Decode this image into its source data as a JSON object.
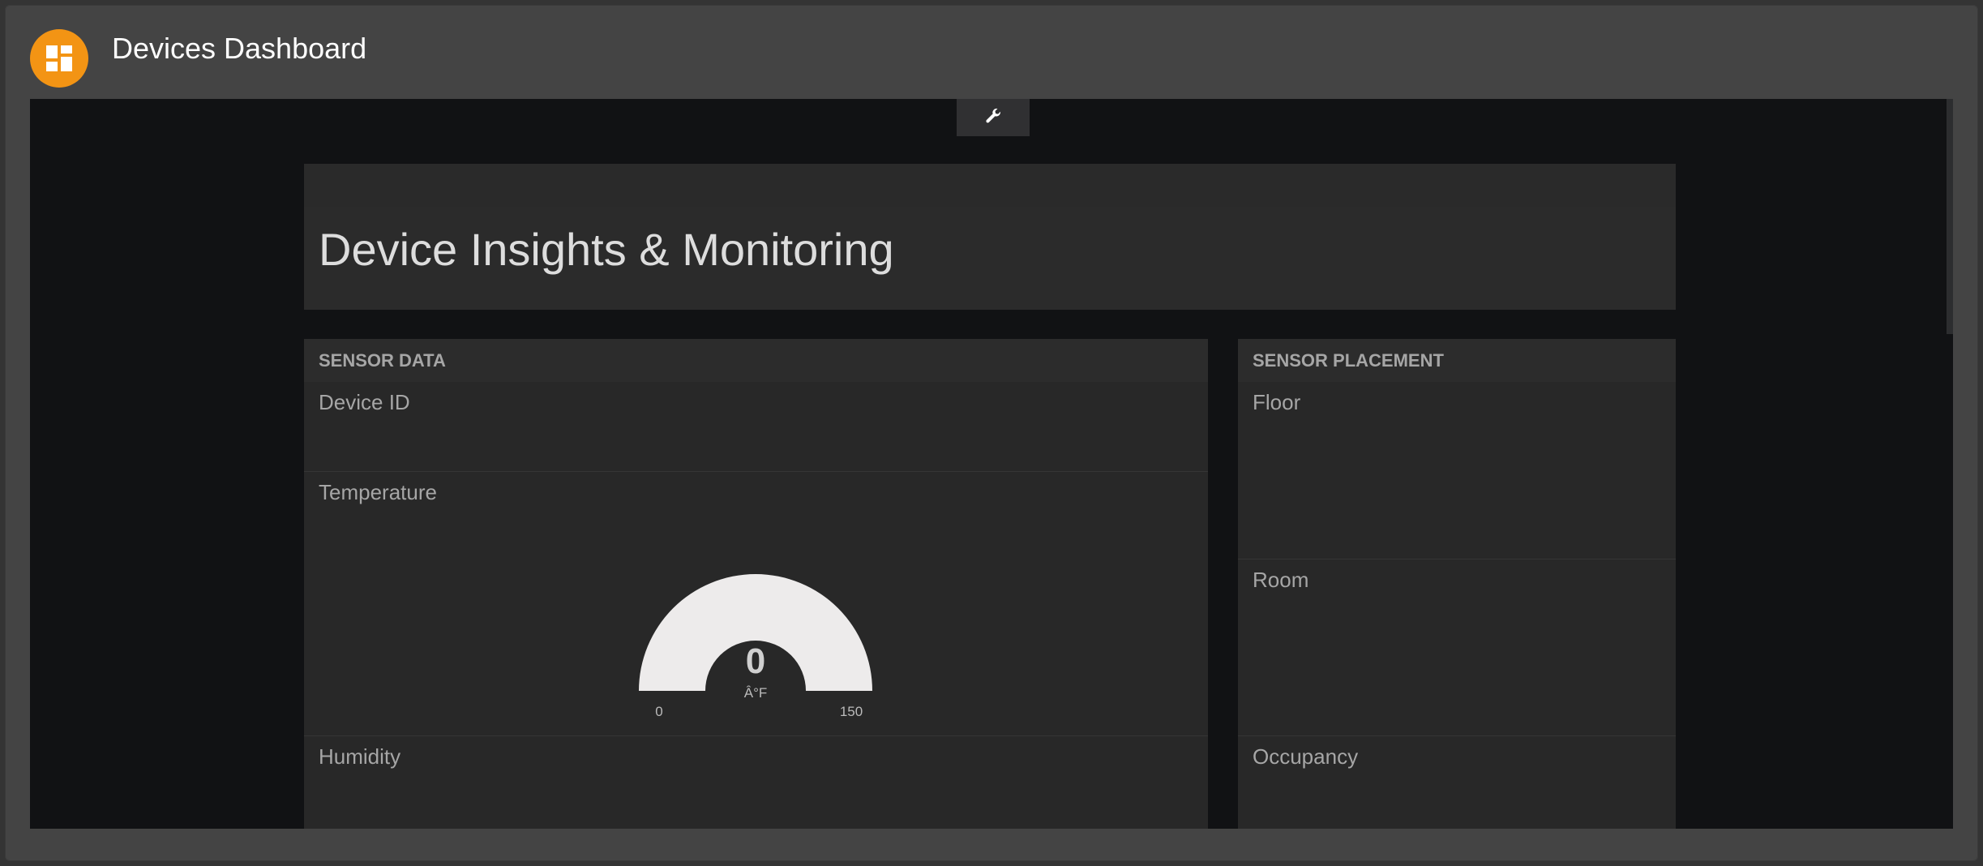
{
  "app": {
    "title": "Devices Dashboard",
    "icon": "dashboard-icon",
    "accent_color": "#f39414"
  },
  "toolbar": {
    "settings_icon": "wrench-icon"
  },
  "page": {
    "title": "Device Insights & Monitoring"
  },
  "panes": {
    "sensor_data": {
      "header": "SENSOR DATA",
      "widgets": {
        "device_id": {
          "title": "Device ID"
        },
        "temperature": {
          "title": "Temperature",
          "gauge": {
            "value": "0",
            "units": "Â°F",
            "min": "0",
            "max": "150"
          }
        },
        "humidity": {
          "title": "Humidity"
        }
      }
    },
    "sensor_placement": {
      "header": "SENSOR PLACEMENT",
      "widgets": {
        "floor": {
          "title": "Floor"
        },
        "room": {
          "title": "Room"
        },
        "occupancy": {
          "title": "Occupancy"
        }
      }
    }
  },
  "colors": {
    "gauge_fill": "#edebeb",
    "panel_bg": "#282828",
    "content_bg": "#111214"
  }
}
